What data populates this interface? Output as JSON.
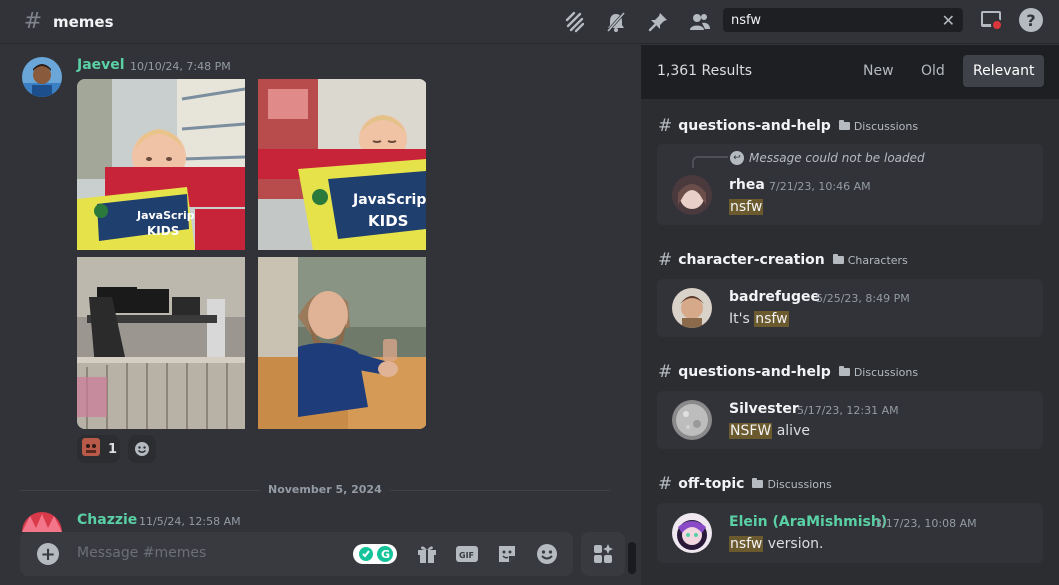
{
  "topbar": {
    "channel_name": "memes",
    "icons": [
      "threads-icon",
      "mute-icon",
      "pin-icon",
      "members-icon"
    ],
    "search_value": "nsfw",
    "inbox_icon": "inbox-icon",
    "help_icon": "help-icon",
    "help_glyph": "?"
  },
  "chat": {
    "message": {
      "author": "Jaevel",
      "timestamp": "10/10/24, 7:48 PM",
      "images": [
        "toddler-javascript-crying",
        "toddler-javascript-sleeping",
        "desk-setup-playpen",
        "bearded-man-at-table"
      ],
      "reaction_count": "1"
    },
    "date_divider": "November 5, 2024",
    "next_message": {
      "author": "Chazzie",
      "timestamp": "11/5/24, 12:58 AM"
    },
    "composer": {
      "placeholder": "Message #memes",
      "icons": [
        "grammarly-icon",
        "gift-icon",
        "gif-icon",
        "sticker-icon",
        "emoji-icon"
      ]
    }
  },
  "results": {
    "count": "1,361 Results",
    "sort_tabs": [
      "New",
      "Old",
      "Relevant"
    ],
    "active_tab": "Relevant",
    "groups": [
      {
        "channel": "questions-and-help",
        "category": "Discussions",
        "reply_text": "Message could not be loaded",
        "author": "rhea",
        "timestamp": "7/21/23, 10:46 AM",
        "text_before": "",
        "highlight": "nsfw",
        "text_after": ""
      },
      {
        "channel": "character-creation",
        "category": "Characters",
        "author": "badrefugee",
        "timestamp": "5/25/23, 8:49 PM",
        "text_before": "It's ",
        "highlight": "nsfw",
        "text_after": ""
      },
      {
        "channel": "questions-and-help",
        "category": "Discussions",
        "author": "Silvester",
        "timestamp": "5/17/23, 12:31 AM",
        "text_before": "",
        "highlight": "NSFW",
        "text_after": " alive"
      },
      {
        "channel": "off-topic",
        "category": "Discussions",
        "author": "Elein (AraMishmish)",
        "timestamp": "3/17/23, 10:08 AM",
        "text_before": "",
        "highlight": "nsfw",
        "text_after": " version."
      }
    ]
  },
  "colors": {
    "accent_author": "#5ad0a5",
    "highlight": "#6b5a2e",
    "background": "#313338",
    "panel": "#2b2d31"
  }
}
